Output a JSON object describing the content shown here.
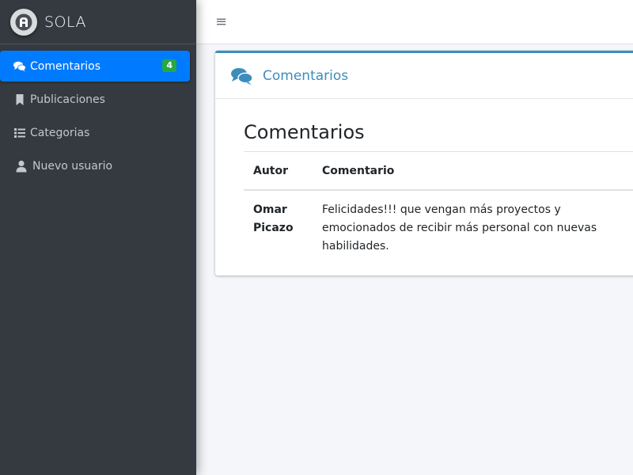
{
  "brand": {
    "name": "SOLA",
    "logo_icon": "a-logo-icon"
  },
  "sidebar": {
    "items": [
      {
        "label": "Comentarios",
        "icon": "comments-icon",
        "badge": "4",
        "active": true
      },
      {
        "label": "Publicaciones",
        "icon": "bookmark-icon",
        "active": false
      },
      {
        "label": "Categorias",
        "icon": "list-icon",
        "active": false
      },
      {
        "label": "Nuevo usuario",
        "icon": "user-icon",
        "active": false
      }
    ]
  },
  "topbar": {
    "menu_icon": "≡"
  },
  "card": {
    "header_title": "Comentarios",
    "section_title": "Comentarios",
    "table": {
      "columns": [
        "Autor",
        "Comentario"
      ],
      "rows": [
        {
          "author": "Omar Picazo",
          "comment": "Felicidades!!! que vengan más proyectos y emocionados de recibir más personal con nuevas habilidades."
        }
      ]
    }
  },
  "colors": {
    "sidebar_bg": "#343a40",
    "active_item": "#007bff",
    "badge": "#28a745",
    "card_accent": "#3c8dbc",
    "page_bg": "#f4f6f9"
  }
}
